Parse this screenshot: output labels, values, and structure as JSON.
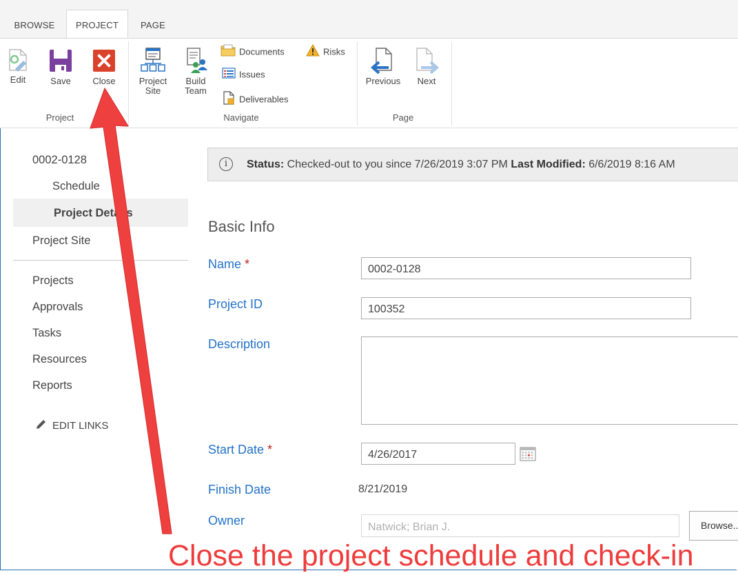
{
  "ribbon": {
    "tabs": [
      {
        "label": "BROWSE"
      },
      {
        "label": "PROJECT"
      },
      {
        "label": "PAGE"
      }
    ],
    "project_group": {
      "label": "Project",
      "edit_label": "Edit",
      "save_label": "Save",
      "close_label": "Close"
    },
    "navigate_group": {
      "label": "Navigate",
      "project_site_line1": "Project",
      "project_site_line2": "Site",
      "build_team_line1": "Build",
      "build_team_line2": "Team",
      "documents_label": "Documents",
      "risks_label": "Risks",
      "issues_label": "Issues",
      "deliverables_label": "Deliverables"
    },
    "page_group": {
      "label": "Page",
      "previous_label": "Previous",
      "next_label": "Next"
    }
  },
  "nav": {
    "project_code": "0002-0128",
    "schedule": "Schedule",
    "project_details": "Project Details",
    "project_site": "Project Site",
    "items": [
      {
        "label": "Projects"
      },
      {
        "label": "Approvals"
      },
      {
        "label": "Tasks"
      },
      {
        "label": "Resources"
      },
      {
        "label": "Reports"
      }
    ],
    "edit_links": "EDIT LINKS"
  },
  "status": {
    "status_label": "Status:",
    "status_text": " Checked-out to you since 7/26/2019 3:07 PM ",
    "modified_label": "Last Modified:",
    "modified_text": " 6/6/2019 8:16 AM"
  },
  "form": {
    "section_title": "Basic Info",
    "name_label": "Name",
    "required_mark": " *",
    "name_value": "0002-0128",
    "project_id_label": "Project ID",
    "project_id_value": "100352",
    "description_label": "Description",
    "description_value": "",
    "start_date_label": "Start Date",
    "start_date_value": "4/26/2017",
    "finish_date_label": "Finish Date",
    "finish_date_value": "8/21/2019",
    "owner_label": "Owner",
    "owner_value": "Natwick; Brian J.",
    "browse_label": "Browse..."
  },
  "annotation": {
    "text": "Close the project schedule and check-in",
    "color": "#ee3b3b"
  }
}
